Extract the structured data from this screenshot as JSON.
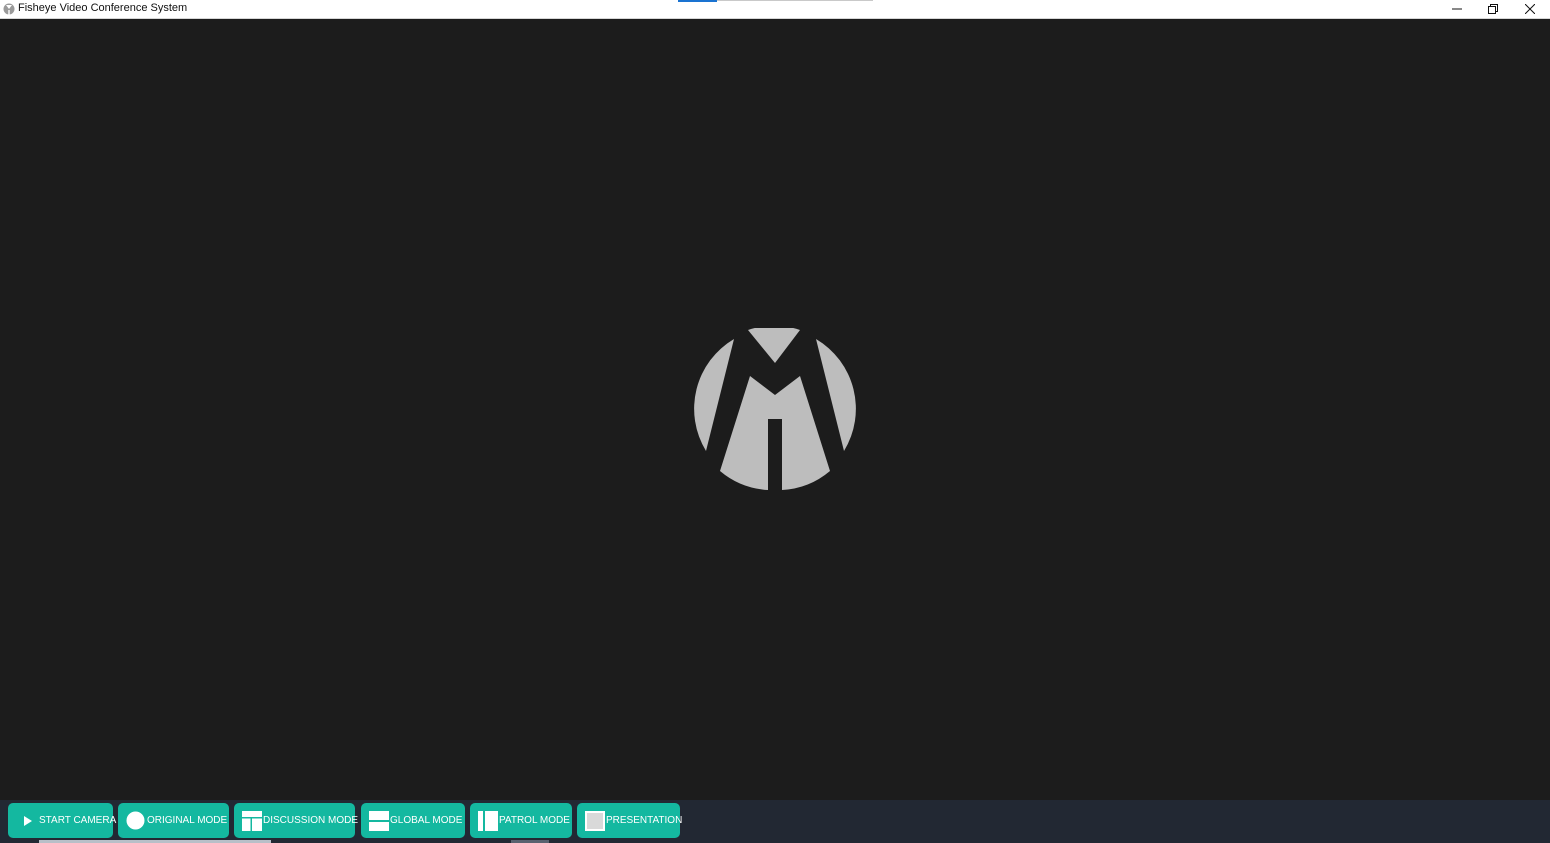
{
  "window": {
    "title": "Fisheye Video Conference System",
    "controls": {
      "minimize_icon": "minimize-icon",
      "maximize_icon": "restore-icon",
      "close_icon": "close-icon"
    }
  },
  "video": {
    "placeholder_logo": "brand-m-logo",
    "logo_color": "#bdbdbd",
    "background_color": "#1c1c1c"
  },
  "toolbar": {
    "accent_color": "#14b8a0",
    "background_color": "#222833",
    "buttons": [
      {
        "label": "START CAMERA",
        "icon": "play-icon"
      },
      {
        "label": "ORIGINAL MODE",
        "icon": "circle-icon"
      },
      {
        "label": "DISCUSSION MODE",
        "icon": "discussion-layout-icon"
      },
      {
        "label": "GLOBAL MODE",
        "icon": "global-layout-icon"
      },
      {
        "label": "PATROL MODE",
        "icon": "patrol-layout-icon"
      },
      {
        "label": "PRESENTATION",
        "icon": "presentation-icon"
      }
    ]
  }
}
